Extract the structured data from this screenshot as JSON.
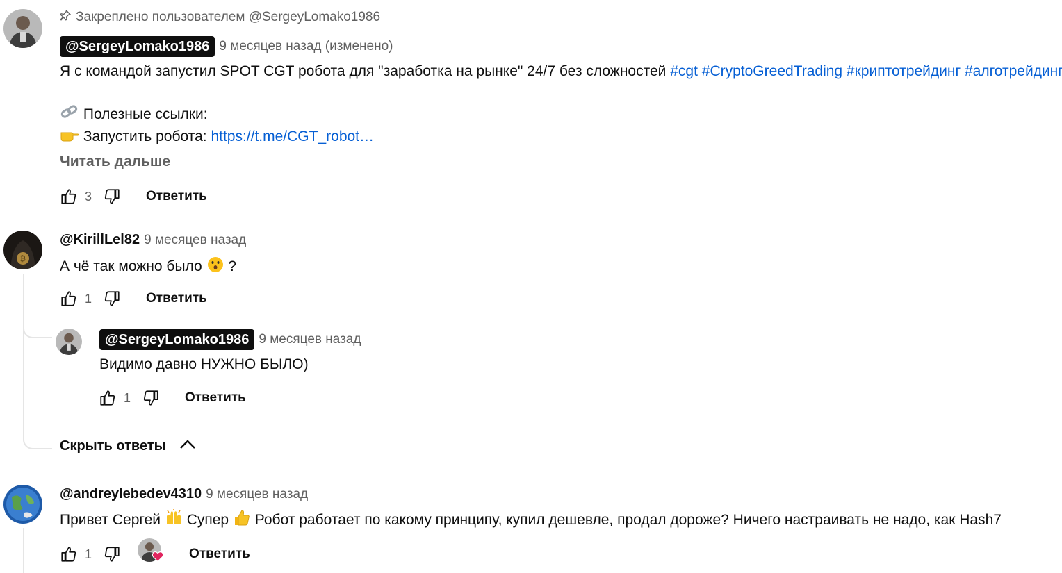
{
  "comments": [
    {
      "pinned_text": "Закреплено пользователем @SergeyLomako1986",
      "author": "@SergeyLomako1986",
      "time": "9 месяцев назад (изменено)",
      "line1_text": "Я с командой запустил SPOT CGT робота для \"заработка на рынке\" 24/7 без сложностей",
      "hashtags": "#cgt #CryptoGreedTrading #криптотрейдинг #алготрейдинг",
      "line2_text": "Полезные ссылки:",
      "line3_text": "Запустить робота:",
      "line3_link": "https://t.me/CGT_robot…",
      "read_more": "Читать дальше",
      "likes": "3",
      "reply_label": "Ответить"
    },
    {
      "author": "@KirillLel82",
      "time": "9 месяцев назад",
      "text": "А чё так можно было",
      "text_suffix": "?",
      "likes": "1",
      "reply_label": "Ответить"
    },
    {
      "author": "@SergeyLomako1986",
      "time": "9 месяцев назад",
      "text": "Видимо давно НУЖНО БЫЛО)",
      "likes": "1",
      "reply_label": "Ответить"
    },
    {
      "author": "@andreylebedev4310",
      "time": "9 месяцев назад",
      "text_a": "Привет Сергей",
      "text_b": "Супер",
      "text_c": "Робот работает по какому принципу, купил дешевле, продал дороже? Ничего настраивать не надо, как Hash7",
      "likes": "1",
      "reply_label": "Ответить"
    }
  ],
  "hide_replies_label": "Скрыть ответы",
  "colors": {
    "link": "#065fd4",
    "muted": "#606060",
    "chip": "#0f0f0f",
    "heart": "#e0245e"
  }
}
